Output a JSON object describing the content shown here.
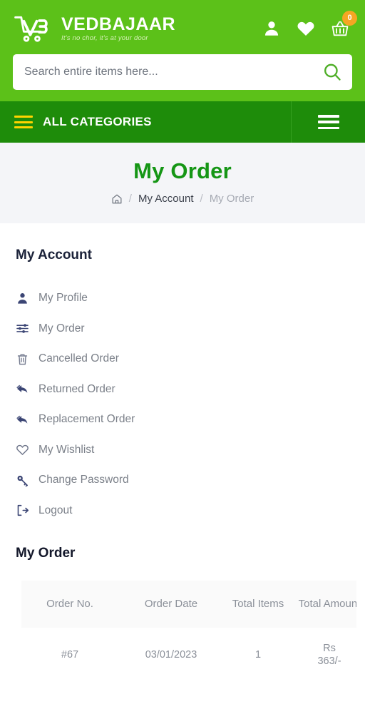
{
  "header": {
    "brand_name": "VEDBAJAAR",
    "tagline": "It's no chor, it's at your door",
    "logo_icon": "cart-vb-logo-icon",
    "account_icon": "user-icon",
    "wishlist_icon": "heart-icon",
    "cart_icon": "shopping-basket-icon",
    "cart_count": "0"
  },
  "search": {
    "placeholder": "Search entire items here...",
    "value": "",
    "button_icon": "search-icon"
  },
  "catnav": {
    "all_categories_label": "ALL CATEGORIES",
    "menu_icon": "hamburger-menu-icon",
    "toggle_icon": "hamburger-menu-icon"
  },
  "breadcrumb": {
    "page_title": "My Order",
    "home_icon": "home-icon",
    "separator": "/",
    "account_label": "My Account",
    "current_label": "My Order"
  },
  "sidebar": {
    "heading": "My Account",
    "items": [
      {
        "label": "My Profile",
        "icon": "user-icon"
      },
      {
        "label": "My Order",
        "icon": "sliders-icon"
      },
      {
        "label": "Cancelled Order",
        "icon": "trash-icon"
      },
      {
        "label": "Returned Order",
        "icon": "reply-arrow-icon"
      },
      {
        "label": "Replacement Order",
        "icon": "reply-arrow-icon"
      },
      {
        "label": "My Wishlist",
        "icon": "heart-outline-icon"
      },
      {
        "label": "Change Password",
        "icon": "key-icon"
      },
      {
        "label": "Logout",
        "icon": "logout-icon"
      }
    ]
  },
  "orders": {
    "section_title": "My Order",
    "columns": [
      "Order No.",
      "Order Date",
      "Total Items",
      "Total Amount"
    ],
    "rows": [
      {
        "order_no": "#67",
        "order_date": "03/01/2023",
        "total_items": "1",
        "amount_currency": "Rs",
        "amount_value": "363/-"
      }
    ]
  },
  "colors": {
    "header_green": "#5cc119",
    "nav_green": "#1e8c0a",
    "title_green": "#159615",
    "badge_orange": "#f5a623",
    "accent_yellow": "#ffd400",
    "icon_navy": "#3b4574",
    "text_gray": "#7b8089",
    "band_gray": "#f4f5f8"
  }
}
